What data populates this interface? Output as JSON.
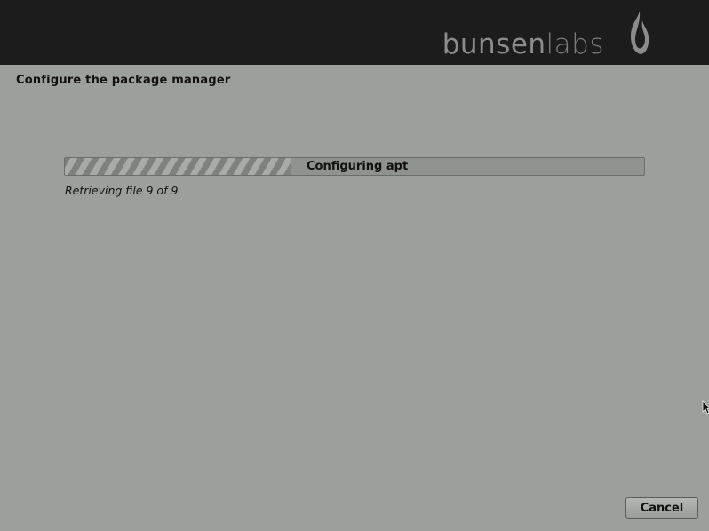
{
  "header": {
    "brand_bold": "bunsen",
    "brand_light": "labs",
    "background_color": "#1c1c1c",
    "logo_icon": "flame-icon"
  },
  "page": {
    "title": "Configure the package manager"
  },
  "progress": {
    "label": "Configuring apt",
    "fraction": 0.39,
    "status": "Retrieving file 9 of 9"
  },
  "buttons": {
    "cancel": "Cancel"
  },
  "colors": {
    "background": "#9ca09c",
    "text": "#111111"
  }
}
